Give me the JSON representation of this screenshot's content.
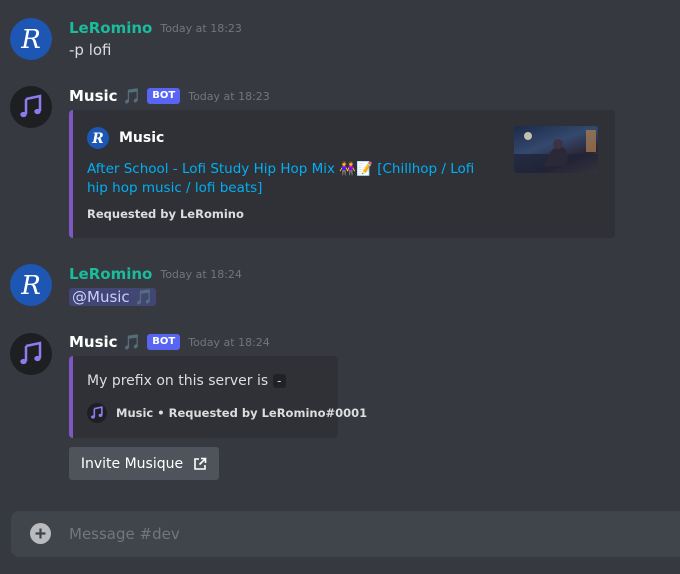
{
  "messages": [
    {
      "author": "LeRomino",
      "timestamp": "Today at 18:23",
      "content": "-p lofi"
    },
    {
      "author": "Music",
      "author_note": "🎵",
      "bot_tag": "BOT",
      "timestamp": "Today at 18:23",
      "embed": {
        "author": "Music",
        "title": "After School - Lofi Study Hip Hop Mix 👭📝 [Chillhop / Lofi hip hop music / lofi beats]",
        "footer": "Requested by LeRomino"
      }
    },
    {
      "author": "LeRomino",
      "timestamp": "Today at 18:24",
      "mention": "@Music",
      "mention_note": "🎵"
    },
    {
      "author": "Music",
      "author_note": "🎵",
      "bot_tag": "BOT",
      "timestamp": "Today at 18:24",
      "embed": {
        "description": "My prefix on this server is",
        "prefix_code": "-",
        "footer": "Music • Requested by LeRomino#0001"
      },
      "button": {
        "label": "Invite Musique"
      }
    }
  ],
  "composer": {
    "placeholder": "Message #dev"
  },
  "colors": {
    "background": "#36393f",
    "user_name": "#1abc9c",
    "bot_tag": "#5865f2",
    "link": "#00aff4",
    "embed_border": "#7e57c2"
  },
  "icons": {
    "user_avatar": "r-logo-avatar",
    "bot_avatar": "music-notes-avatar",
    "button_icon": "external-link-icon",
    "composer_icon": "plus-circle-icon"
  }
}
